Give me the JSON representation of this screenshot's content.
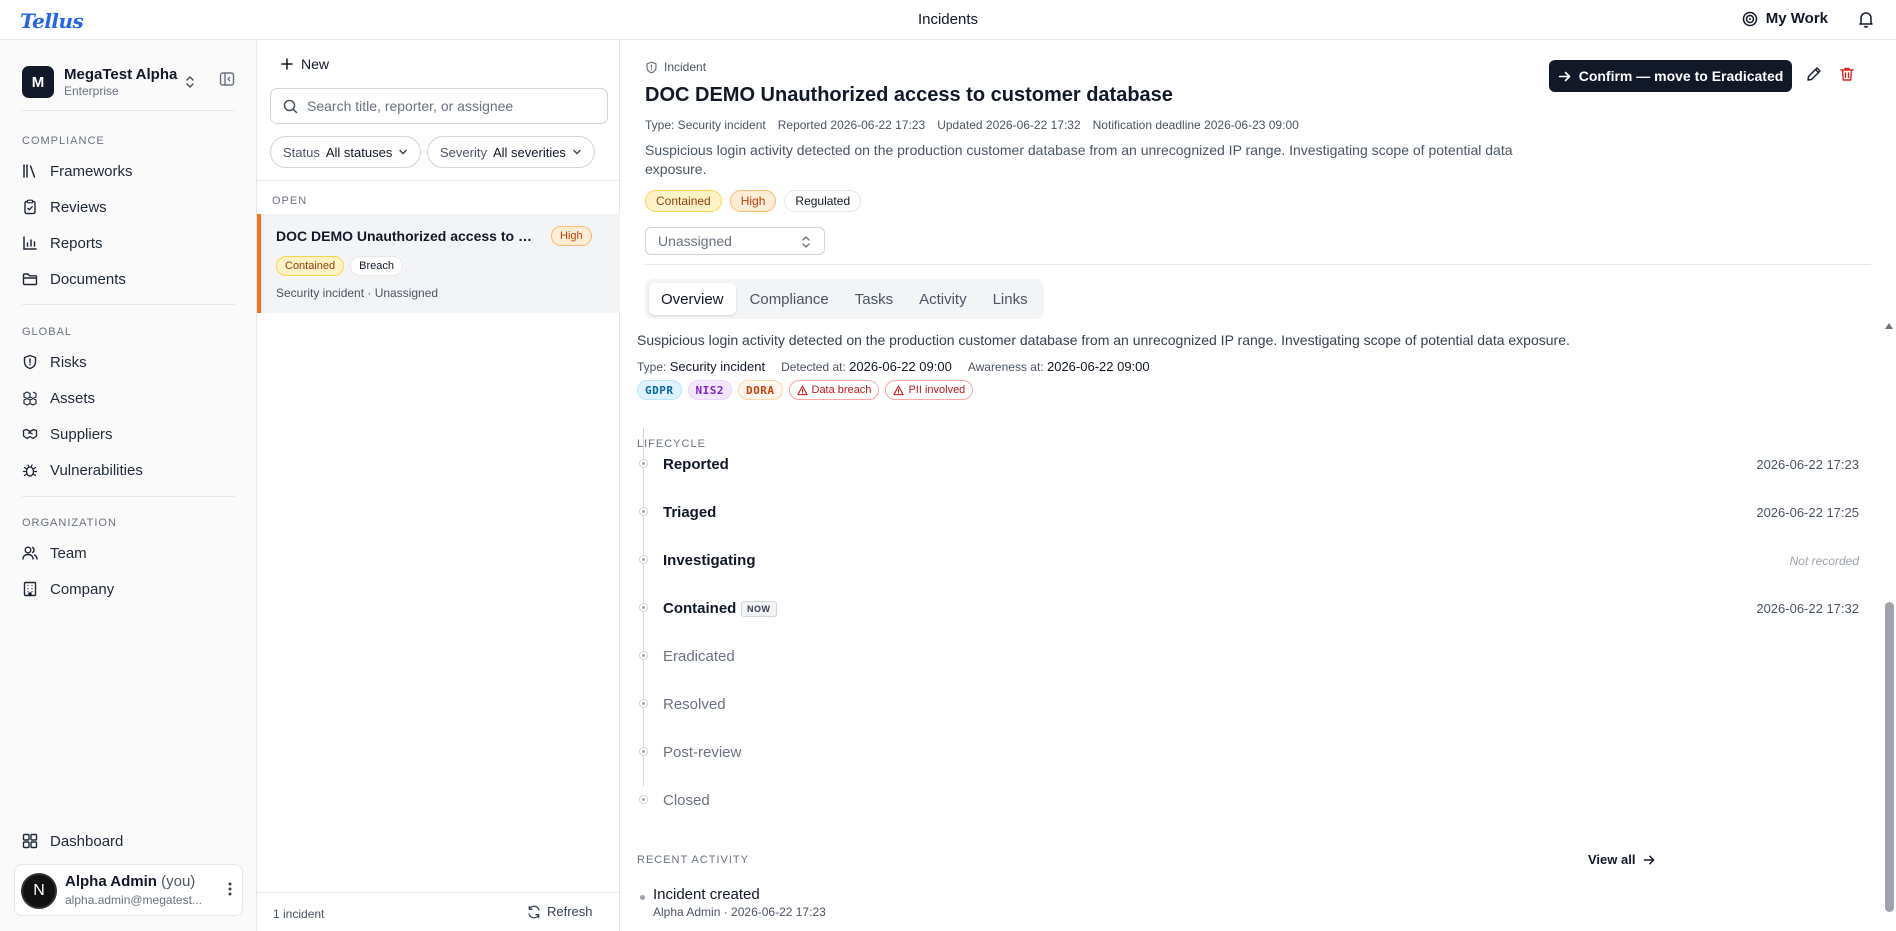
{
  "app": {
    "logo": "Tellus",
    "page_title": "Incidents",
    "my_work": "My Work"
  },
  "org": {
    "initial": "M",
    "name": "MegaTest Alpha",
    "plan": "Enterprise"
  },
  "sidebar": {
    "sections": [
      {
        "label": "COMPLIANCE",
        "items": [
          {
            "label": "Frameworks",
            "icon": "frameworks-icon"
          },
          {
            "label": "Reviews",
            "icon": "clipboard-check-icon"
          },
          {
            "label": "Reports",
            "icon": "bar-chart-icon"
          },
          {
            "label": "Documents",
            "icon": "folder-icon"
          }
        ]
      },
      {
        "label": "GLOBAL",
        "items": [
          {
            "label": "Risks",
            "icon": "shield-alert-icon"
          },
          {
            "label": "Assets",
            "icon": "boxes-icon"
          },
          {
            "label": "Suppliers",
            "icon": "handshake-icon"
          },
          {
            "label": "Vulnerabilities",
            "icon": "bug-icon"
          }
        ]
      },
      {
        "label": "ORGANIZATION",
        "items": [
          {
            "label": "Team",
            "icon": "users-icon"
          },
          {
            "label": "Company",
            "icon": "building-icon"
          }
        ]
      }
    ],
    "dashboard": "Dashboard",
    "user": {
      "initial": "N",
      "name": "Alpha Admin",
      "you": "(you)",
      "email": "alpha.admin@megatest..."
    }
  },
  "list": {
    "new_label": "New",
    "search_placeholder": "Search title, reporter, or assignee",
    "filters": [
      {
        "label": "Status",
        "value": "All statuses"
      },
      {
        "label": "Severity",
        "value": "All severities"
      }
    ],
    "group_label": "OPEN",
    "items": [
      {
        "title": "DOC DEMO Unauthorized access to c...",
        "severity": "High",
        "status": "Contained",
        "tag": "Breach",
        "meta": "Security incident · Unassigned"
      }
    ],
    "count": "1 incident",
    "refresh": "Refresh"
  },
  "detail": {
    "kicker": "Incident",
    "title": "DOC DEMO Unauthorized access to customer database",
    "meta": [
      "Type: Security incident",
      "Reported 2026-06-22 17:23",
      "Updated 2026-06-22 17:32",
      "Notification deadline 2026-06-23 09:00"
    ],
    "description": "Suspicious login activity detected on the production customer database from an unrecognized IP range. Investigating scope of potential data exposure.",
    "badges": {
      "status": "Contained",
      "severity": "High",
      "regulated": "Regulated"
    },
    "assignee_placeholder": "Unassigned",
    "confirm_button": "Confirm — move to Eradicated",
    "tabs": [
      "Overview",
      "Compliance",
      "Tasks",
      "Activity",
      "Links"
    ],
    "active_tab": "Overview",
    "overview": {
      "description": "Suspicious login activity detected on the production customer database from an unrecognized IP range. Investigating scope of potential data exposure.",
      "type_label": "Type:",
      "type_value": "Security incident",
      "detected_label": "Detected at:",
      "detected_value": "2026-06-22 09:00",
      "awareness_label": "Awareness at:",
      "awareness_value": "2026-06-22 09:00",
      "tags": [
        "GDPR",
        "NIS2",
        "DORA"
      ],
      "flags": [
        "Data breach",
        "PII involved"
      ]
    },
    "lifecycle_label": "LIFECYCLE",
    "lifecycle": [
      {
        "label": "Reported",
        "time": "2026-06-22 17:23",
        "state": "done"
      },
      {
        "label": "Triaged",
        "time": "2026-06-22 17:25",
        "state": "done"
      },
      {
        "label": "Investigating",
        "time": "Not recorded",
        "state": "done"
      },
      {
        "label": "Contained",
        "time": "2026-06-22 17:32",
        "state": "done",
        "badge": "NOW"
      },
      {
        "label": "Eradicated",
        "time": "",
        "state": "future"
      },
      {
        "label": "Resolved",
        "time": "",
        "state": "future"
      },
      {
        "label": "Post-review",
        "time": "",
        "state": "future"
      },
      {
        "label": "Closed",
        "time": "",
        "state": "future"
      }
    ],
    "recent_activity_label": "RECENT ACTIVITY",
    "view_all": "View all",
    "activity": [
      {
        "title": "Incident created",
        "meta": "Alpha Admin · 2026-06-22 17:23"
      }
    ]
  },
  "colors": {
    "accent": "#111827",
    "high": "#c2410c",
    "contained": "#92400e",
    "danger": "#dc2626",
    "link": "#2563eb"
  }
}
